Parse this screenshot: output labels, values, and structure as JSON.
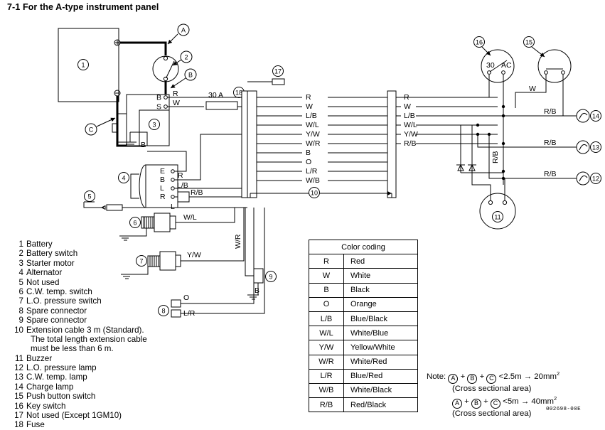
{
  "title": "7-1 For the A-type instrument panel",
  "doc_id": "002698-00E",
  "legend": {
    "items": [
      {
        "num": "1",
        "label": "Battery"
      },
      {
        "num": "2",
        "label": "Battery switch"
      },
      {
        "num": "3",
        "label": "Starter motor"
      },
      {
        "num": "4",
        "label": "Alternator"
      },
      {
        "num": "5",
        "label": "Not used"
      },
      {
        "num": "6",
        "label": "C.W. temp. switch"
      },
      {
        "num": "7",
        "label": "L.O. pressure switch"
      },
      {
        "num": "8",
        "label": "Spare connector"
      },
      {
        "num": "9",
        "label": "Spare connector"
      },
      {
        "num": "10",
        "label": "Extension cable 3 m (Standard).",
        "cont": [
          "The total length extension cable",
          "must be less than 6 m."
        ]
      },
      {
        "num": "11",
        "label": "Buzzer"
      },
      {
        "num": "12",
        "label": "L.O. pressure lamp"
      },
      {
        "num": "13",
        "label": "C.W. temp. lamp"
      },
      {
        "num": "14",
        "label": "Charge lamp"
      },
      {
        "num": "15",
        "label": "Push button switch"
      },
      {
        "num": "16",
        "label": "Key switch"
      },
      {
        "num": "17",
        "label": "Not used (Except 1GM10)"
      },
      {
        "num": "18",
        "label": "Fuse"
      }
    ]
  },
  "color_table": {
    "header": "Color coding",
    "rows": [
      {
        "code": "R",
        "name": "Red"
      },
      {
        "code": "W",
        "name": "White"
      },
      {
        "code": "B",
        "name": "Black"
      },
      {
        "code": "O",
        "name": "Orange"
      },
      {
        "code": "L/B",
        "name": "Blue/Black"
      },
      {
        "code": "W/L",
        "name": "White/Blue"
      },
      {
        "code": "Y/W",
        "name": "Yellow/White"
      },
      {
        "code": "W/R",
        "name": "White/Red"
      },
      {
        "code": "L/R",
        "name": "Blue/Red"
      },
      {
        "code": "W/B",
        "name": "White/Black"
      },
      {
        "code": "R/B",
        "name": "Red/Black"
      }
    ]
  },
  "note": {
    "line1_prefix": "Note:",
    "line1_cond": "<2.5m",
    "line1_arrow": "→",
    "line1_result": "20mm",
    "line1_exp": "2",
    "line2": "(Cross sectional area)",
    "line3_cond": "<5m",
    "line3_arrow": "→",
    "line3_result": "40mm",
    "line3_exp": "2",
    "line4": "(Cross sectional area)",
    "marker_a": "A",
    "marker_b": "B",
    "marker_c": "C",
    "plus": "+"
  },
  "diagram": {
    "cable_markers": [
      "A",
      "B",
      "C"
    ],
    "fuse_rating": "30 A",
    "starter_terminals": [
      "B",
      "S"
    ],
    "alternator_terminals": [
      "E",
      "B",
      "L",
      "R"
    ],
    "key_switch_terminals": [
      "30",
      "AC"
    ],
    "bundle_left": [
      "R",
      "W",
      "L/B",
      "W/L",
      "Y/W",
      "W/R",
      "B",
      "O",
      "L/R",
      "W/B"
    ],
    "bundle_right": [
      "R",
      "W",
      "L/B",
      "W/L",
      "Y/W",
      "R/B"
    ],
    "wire_labels": {
      "starter_b": "R",
      "starter_s": "W",
      "alt_b": "R",
      "alt_l": "L/B",
      "alt_r": "R/B",
      "alt_lower": "L",
      "ground_b": "B",
      "cw_switch": "W/L",
      "lo_switch": "Y/W",
      "spare8_top": "O",
      "spare8_bot": "L/R",
      "spare9": "W/R",
      "spare9_gnd": "B",
      "push_w": "W",
      "buzzer_rb": "R/B",
      "lamp14": "R/B",
      "lamp13": "R/B",
      "lamp12": "R/B"
    },
    "item_numbers": [
      "1",
      "2",
      "3",
      "4",
      "5",
      "6",
      "7",
      "8",
      "9",
      "10",
      "11",
      "12",
      "13",
      "14",
      "15",
      "16",
      "17",
      "18"
    ]
  }
}
